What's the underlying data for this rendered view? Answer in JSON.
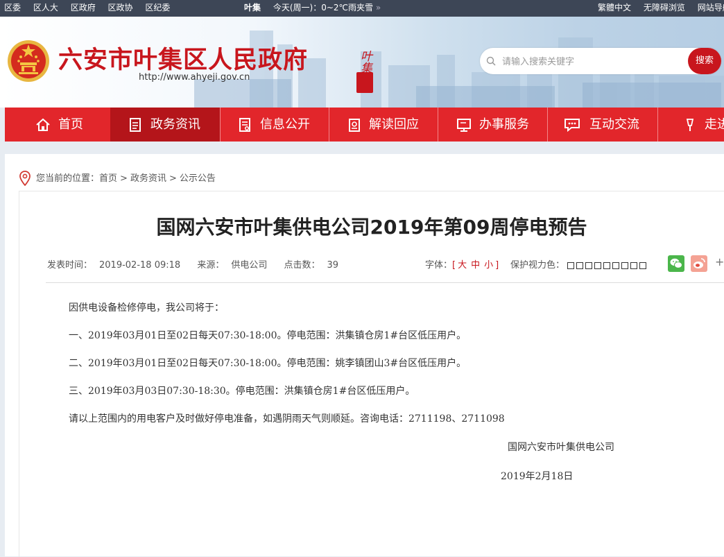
{
  "topbar": {
    "links": [
      "区委",
      "区人大",
      "区政府",
      "区政协",
      "区纪委"
    ],
    "weather_city": "叶集",
    "weather": "今天(周一)：0~2℃雨夹雪",
    "weather_more": "»",
    "right_links": [
      "繁體中文",
      "无障碍浏览",
      "网站导航"
    ]
  },
  "header": {
    "title": "六安市叶集区人民政府",
    "url": "http://www.ahyeji.gov.cn",
    "seal_text": "叶集",
    "search_placeholder": "请输入搜索关键字",
    "search_button": "搜索"
  },
  "nav": {
    "items": [
      {
        "label": "首页",
        "icon": "home-icon"
      },
      {
        "label": "政务资讯",
        "icon": "document-icon"
      },
      {
        "label": "信息公开",
        "icon": "list-doc-icon"
      },
      {
        "label": "解读回应",
        "icon": "badge-icon"
      },
      {
        "label": "办事服务",
        "icon": "monitor-icon"
      },
      {
        "label": "互动交流",
        "icon": "chat-icon"
      },
      {
        "label": "走进",
        "icon": "torch-icon"
      }
    ]
  },
  "breadcrumb": {
    "prefix": "您当前的位置：",
    "items": [
      "首页",
      "政务资讯",
      "公示公告"
    ],
    "separator": ">"
  },
  "article": {
    "title": "国网六安市叶集供电公司2019年第09周停电预告",
    "publish_label": "发表时间：",
    "publish_time": "2019-02-18 09:18",
    "source_label": "来源：",
    "source": "供电公司",
    "clicks_label": "点击数：",
    "clicks": "39",
    "font_label": "字体：",
    "font_open": "[",
    "font_sizes": [
      "大",
      "中",
      "小"
    ],
    "font_close": "]",
    "eye_label": "保护视力色：",
    "eye_colors": [
      "#ffffff",
      "#ffffff",
      "#ffffff",
      "#ffffff",
      "#ffffff",
      "#ffffff",
      "#ffffff",
      "#ffffff",
      "#ffffff"
    ],
    "paragraphs": [
      "因供电设备检修停电，我公司将于：",
      "一、2019年03月01日至02日每天07:30-18:00。停电范围：洪集镇仓房1#台区低压用户。",
      "二、2019年03月01日至02日每天07:30-18:00。停电范围：姚李镇团山3#台区低压用户。",
      "三、2019年03月03日07:30-18:30。停电范围：洪集镇仓房1#台区低压用户。",
      "请以上范围内的用电客户及时做好停电准备，如遇阴雨天气则顺延。咨询电话：2711198、2711098"
    ],
    "signature": "国网六安市叶集供电公司",
    "date": "2019年2月18日"
  },
  "colors": {
    "topbar": "#3d4656",
    "brand_red": "#c8161d",
    "nav_bg": "#e2262b",
    "nav_active": "#b4151a",
    "page_bg": "#e7ecf2"
  }
}
